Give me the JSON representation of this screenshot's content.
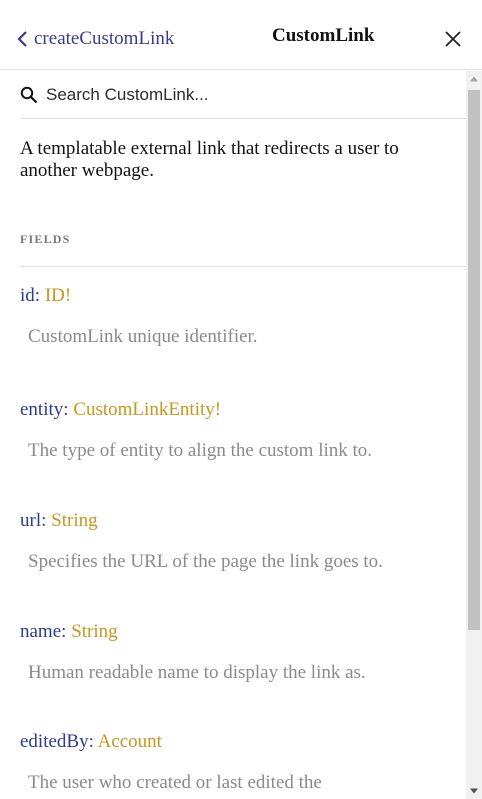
{
  "header": {
    "back_label": "createCustomLink",
    "title": "CustomLink"
  },
  "search": {
    "placeholder": "Search CustomLink..."
  },
  "description": "A templatable external link that redirects a user to another webpage.",
  "fields_heading": "FIELDS",
  "fields": [
    {
      "name": "id",
      "type": "ID",
      "non_null": "!",
      "description": "CustomLink unique identifier."
    },
    {
      "name": "entity",
      "type": "CustomLinkEntity",
      "non_null": "!",
      "description": "The type of entity to align the custom link to."
    },
    {
      "name": "url",
      "type": "String",
      "non_null": "",
      "description": "Specifies the URL of the page the link goes to."
    },
    {
      "name": "name",
      "type": "String",
      "non_null": "",
      "description": "Human readable name to display the link as."
    },
    {
      "name": "editedBy",
      "type": "Account",
      "non_null": "",
      "description": "The user who created or last edited the"
    }
  ],
  "colors": {
    "field_name": "#2f3a8f",
    "field_type": "#c8961d",
    "description_text": "#8a8a8a",
    "back_link": "#3b3a8f"
  }
}
